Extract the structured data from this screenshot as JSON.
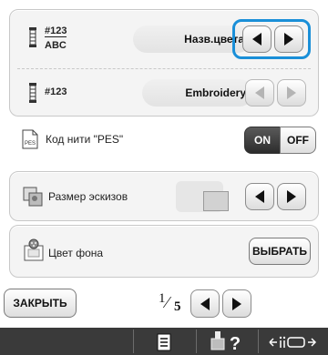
{
  "rows": {
    "thread_display": {
      "label_top": "#123",
      "label_bottom": "ABC",
      "value": "Назв.цвета"
    },
    "thread_number": {
      "label": "#123",
      "value": "Embroidery"
    },
    "pes_code": {
      "label": "Код нити \"PES\"",
      "on_label": "ON",
      "off_label": "OFF"
    },
    "thumb_size": {
      "label": "Размер эскизов"
    },
    "bg_color": {
      "label": "Цвет фона",
      "button_label": "ВЫБРАТЬ"
    }
  },
  "nav": {
    "close_label": "ЗАКРЫТЬ",
    "page_current": "1",
    "page_total": "5"
  },
  "icons": {
    "thread_spool": "thread-spool-icon",
    "pes_file": "pes-file-icon",
    "thumbnail": "thumbnail-size-icon",
    "background": "background-color-icon",
    "arrow_left": "arrow-left-icon",
    "arrow_right": "arrow-right-icon",
    "footer_settings": "settings-list-icon",
    "footer_help": "help-icon",
    "footer_machine": "machine-icon"
  },
  "colors": {
    "highlight": "#1a8fd8",
    "footer": "#3a3a3a"
  }
}
